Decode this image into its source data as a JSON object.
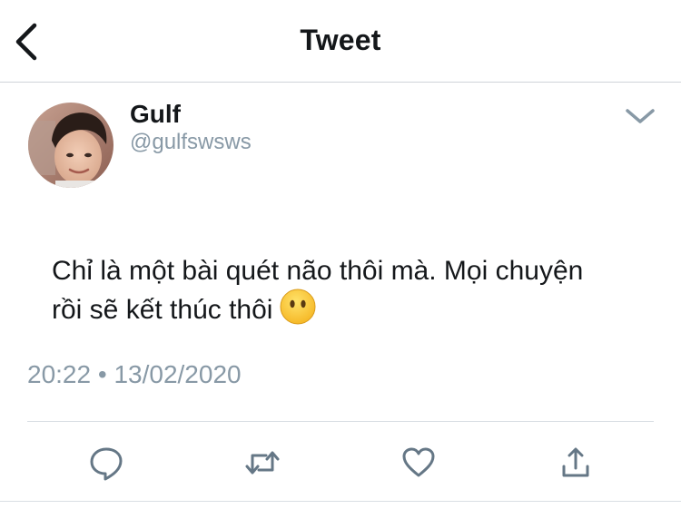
{
  "header": {
    "title": "Tweet",
    "back_icon": "chevron-left-icon"
  },
  "tweet": {
    "author_name": "Gulf",
    "author_handle": "@gulfswsws",
    "text_line1": "Chỉ là một bài quét não thôi mà. Mọi chuyện",
    "text_line2": "rồi sẽ kết thúc thôi",
    "emoji": "face-without-mouth-emoji",
    "time": "20:22",
    "separator": "•",
    "date": "13/02/2020"
  },
  "actions": [
    {
      "name": "reply",
      "icon": "reply-icon"
    },
    {
      "name": "retweet",
      "icon": "retweet-icon"
    },
    {
      "name": "like",
      "icon": "heart-icon"
    },
    {
      "name": "share",
      "icon": "share-icon"
    }
  ],
  "colors": {
    "text": "#14171a",
    "secondary": "#8899a6",
    "icon": "#657786",
    "divider": "#d9dee3"
  }
}
